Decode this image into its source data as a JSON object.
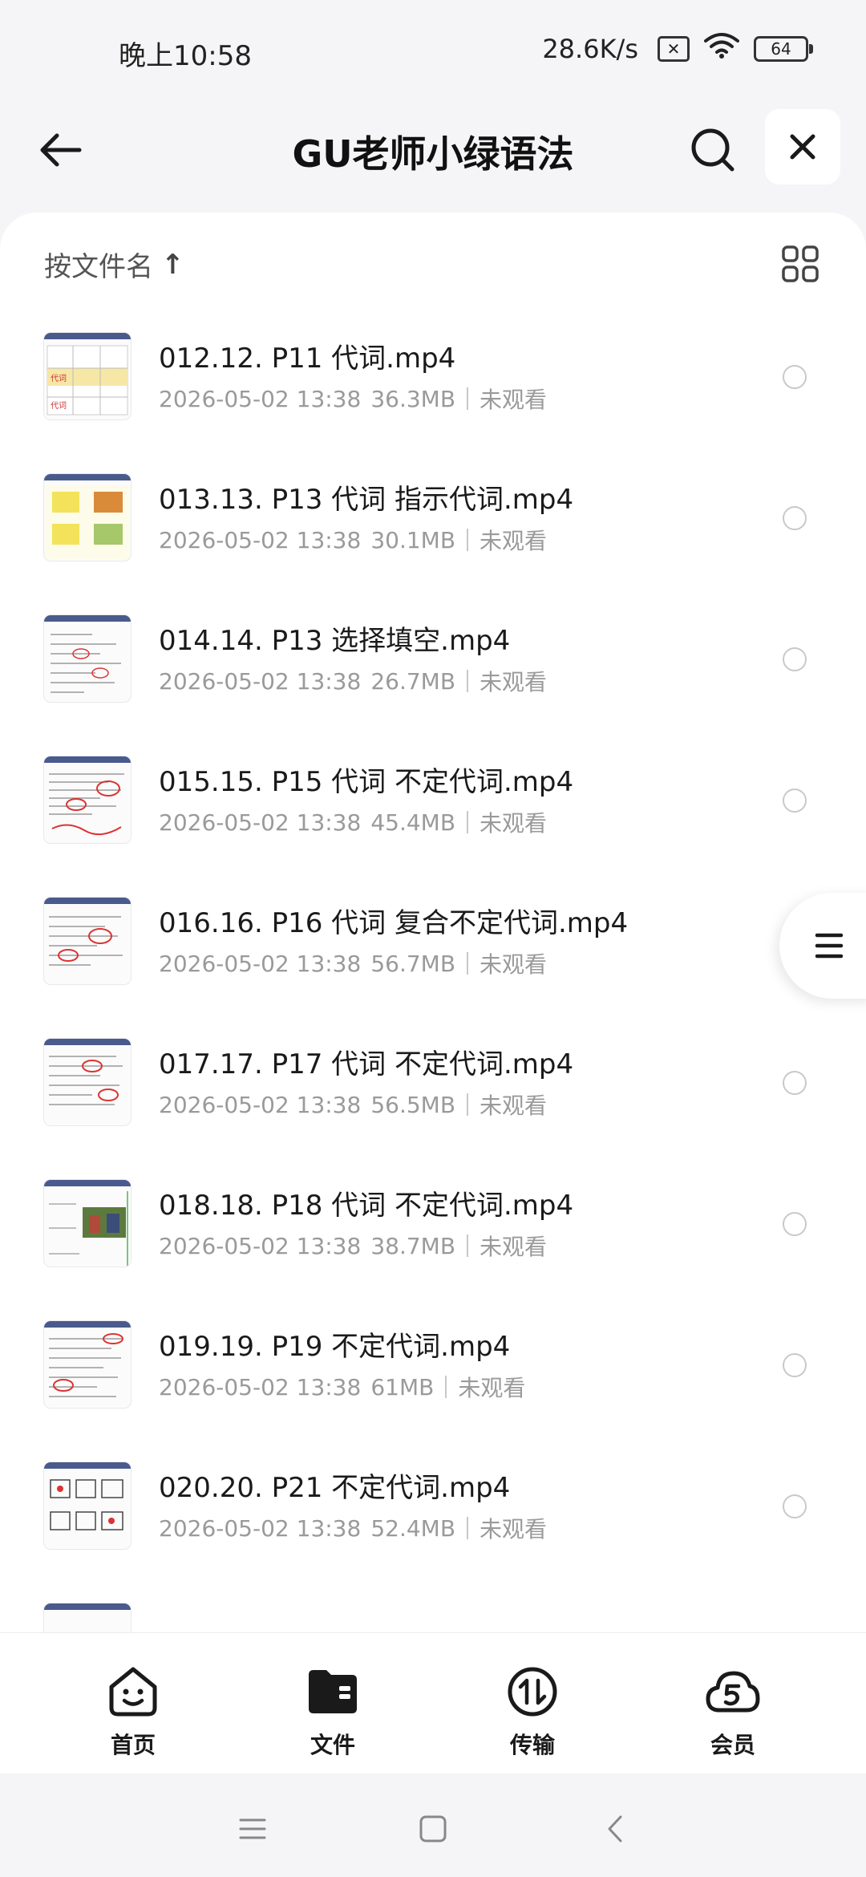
{
  "status_bar": {
    "time": "晚上10:58",
    "net_speed": "28.6K/s",
    "sim_glyph": "✕",
    "battery": "64"
  },
  "header": {
    "title": "GU老师小绿语法"
  },
  "sort": {
    "label": "按文件名",
    "arrow": "↑"
  },
  "files": [
    {
      "name": "012.12. P11 代词.mp4",
      "date": "2026-05-02 13:38",
      "size": "36.3MB",
      "status": "未观看"
    },
    {
      "name": "013.13. P13 代词 指示代词.mp4",
      "date": "2026-05-02 13:38",
      "size": "30.1MB",
      "status": "未观看"
    },
    {
      "name": "014.14. P13 选择填空.mp4",
      "date": "2026-05-02 13:38",
      "size": "26.7MB",
      "status": "未观看"
    },
    {
      "name": "015.15. P15 代词 不定代词.mp4",
      "date": "2026-05-02 13:38",
      "size": "45.4MB",
      "status": "未观看"
    },
    {
      "name": "016.16. P16 代词 复合不定代词.mp4",
      "date": "2026-05-02 13:38",
      "size": "56.7MB",
      "status": "未观看"
    },
    {
      "name": "017.17. P17 代词 不定代词.mp4",
      "date": "2026-05-02 13:38",
      "size": "56.5MB",
      "status": "未观看"
    },
    {
      "name": "018.18. P18 代词 不定代词.mp4",
      "date": "2026-05-02 13:38",
      "size": "38.7MB",
      "status": "未观看"
    },
    {
      "name": "019.19. P19 不定代词.mp4",
      "date": "2026-05-02 13:38",
      "size": "61MB",
      "status": "未观看"
    },
    {
      "name": "020.20. P21 不定代词.mp4",
      "date": "2026-05-02 13:38",
      "size": "52.4MB",
      "status": "未观看"
    }
  ],
  "bottom_nav": {
    "home": "首页",
    "files": "文件",
    "transfer": "传输",
    "vip": "会员"
  }
}
